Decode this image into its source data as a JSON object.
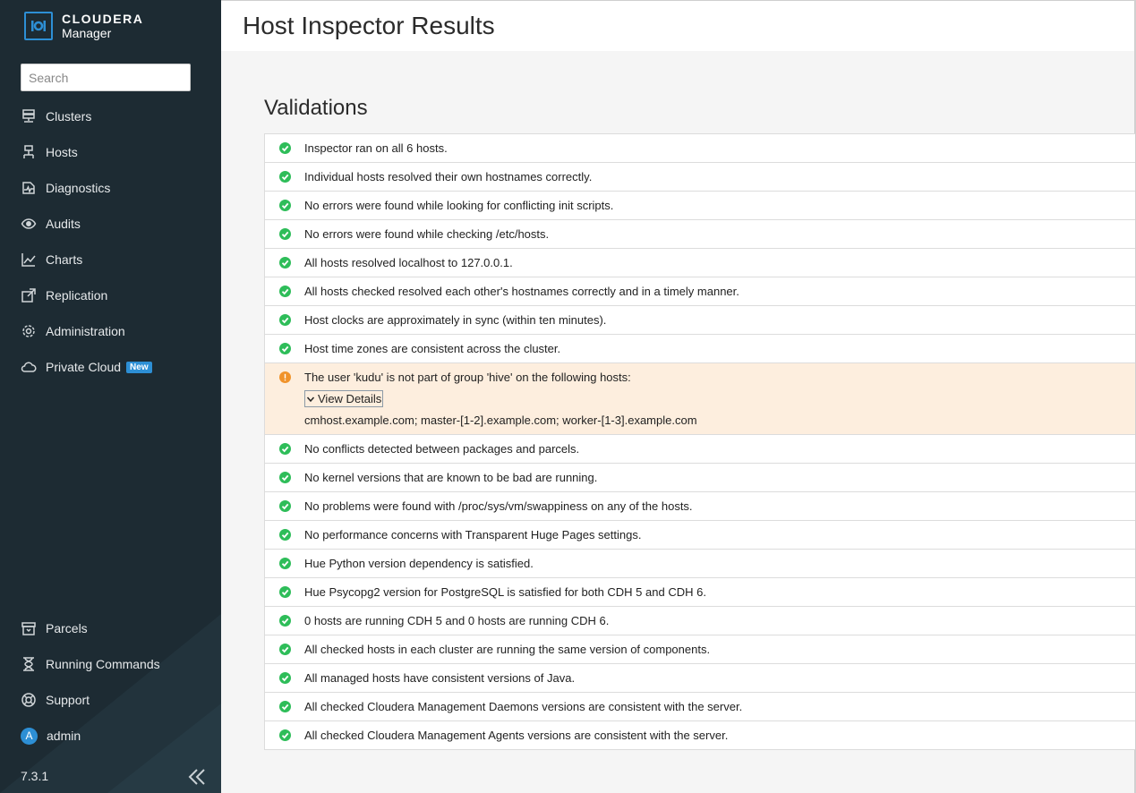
{
  "brand": {
    "name": "CLOUDERA",
    "product": "Manager"
  },
  "search": {
    "placeholder": "Search"
  },
  "nav": {
    "clusters": "Clusters",
    "hosts": "Hosts",
    "diagnostics": "Diagnostics",
    "audits": "Audits",
    "charts": "Charts",
    "replication": "Replication",
    "administration": "Administration",
    "private_cloud": "Private Cloud",
    "private_cloud_badge": "New",
    "parcels": "Parcels",
    "running_commands": "Running Commands",
    "support": "Support",
    "user": "admin",
    "user_initial": "A"
  },
  "version": "7.3.1",
  "page": {
    "title": "Host Inspector Results",
    "section": "Validations"
  },
  "colors": {
    "sidebar": "#1d2b33",
    "accent": "#2d8fd5",
    "success": "#2ebd59",
    "warning": "#f0932b",
    "warning_bg": "#fdeede"
  },
  "validations": [
    {
      "status": "success",
      "text": "Inspector ran on all 6 hosts."
    },
    {
      "status": "success",
      "text": "Individual hosts resolved their own hostnames correctly."
    },
    {
      "status": "success",
      "text": "No errors were found while looking for conflicting init scripts."
    },
    {
      "status": "success",
      "text": "No errors were found while checking /etc/hosts."
    },
    {
      "status": "success",
      "text": "All hosts resolved localhost to 127.0.0.1."
    },
    {
      "status": "success",
      "text": "All hosts checked resolved each other's hostnames correctly and in a timely manner."
    },
    {
      "status": "success",
      "text": "Host clocks are approximately in sync (within ten minutes)."
    },
    {
      "status": "success",
      "text": "Host time zones are consistent across the cluster."
    },
    {
      "status": "warning",
      "text": "The user 'kudu' is not part of group 'hive' on the following hosts:",
      "details_label": "View Details",
      "hosts": "cmhost.example.com; master-[1-2].example.com; worker-[1-3].example.com"
    },
    {
      "status": "success",
      "text": "No conflicts detected between packages and parcels."
    },
    {
      "status": "success",
      "text": "No kernel versions that are known to be bad are running."
    },
    {
      "status": "success",
      "text": "No problems were found with /proc/sys/vm/swappiness on any of the hosts."
    },
    {
      "status": "success",
      "text": "No performance concerns with Transparent Huge Pages settings."
    },
    {
      "status": "success",
      "text": "Hue Python version dependency is satisfied."
    },
    {
      "status": "success",
      "text": "Hue Psycopg2 version for PostgreSQL is satisfied for both CDH 5 and CDH 6."
    },
    {
      "status": "success",
      "text": "0 hosts are running CDH 5 and 0 hosts are running CDH 6."
    },
    {
      "status": "success",
      "text": "All checked hosts in each cluster are running the same version of components."
    },
    {
      "status": "success",
      "text": "All managed hosts have consistent versions of Java."
    },
    {
      "status": "success",
      "text": "All checked Cloudera Management Daemons versions are consistent with the server."
    },
    {
      "status": "success",
      "text": "All checked Cloudera Management Agents versions are consistent with the server."
    }
  ]
}
